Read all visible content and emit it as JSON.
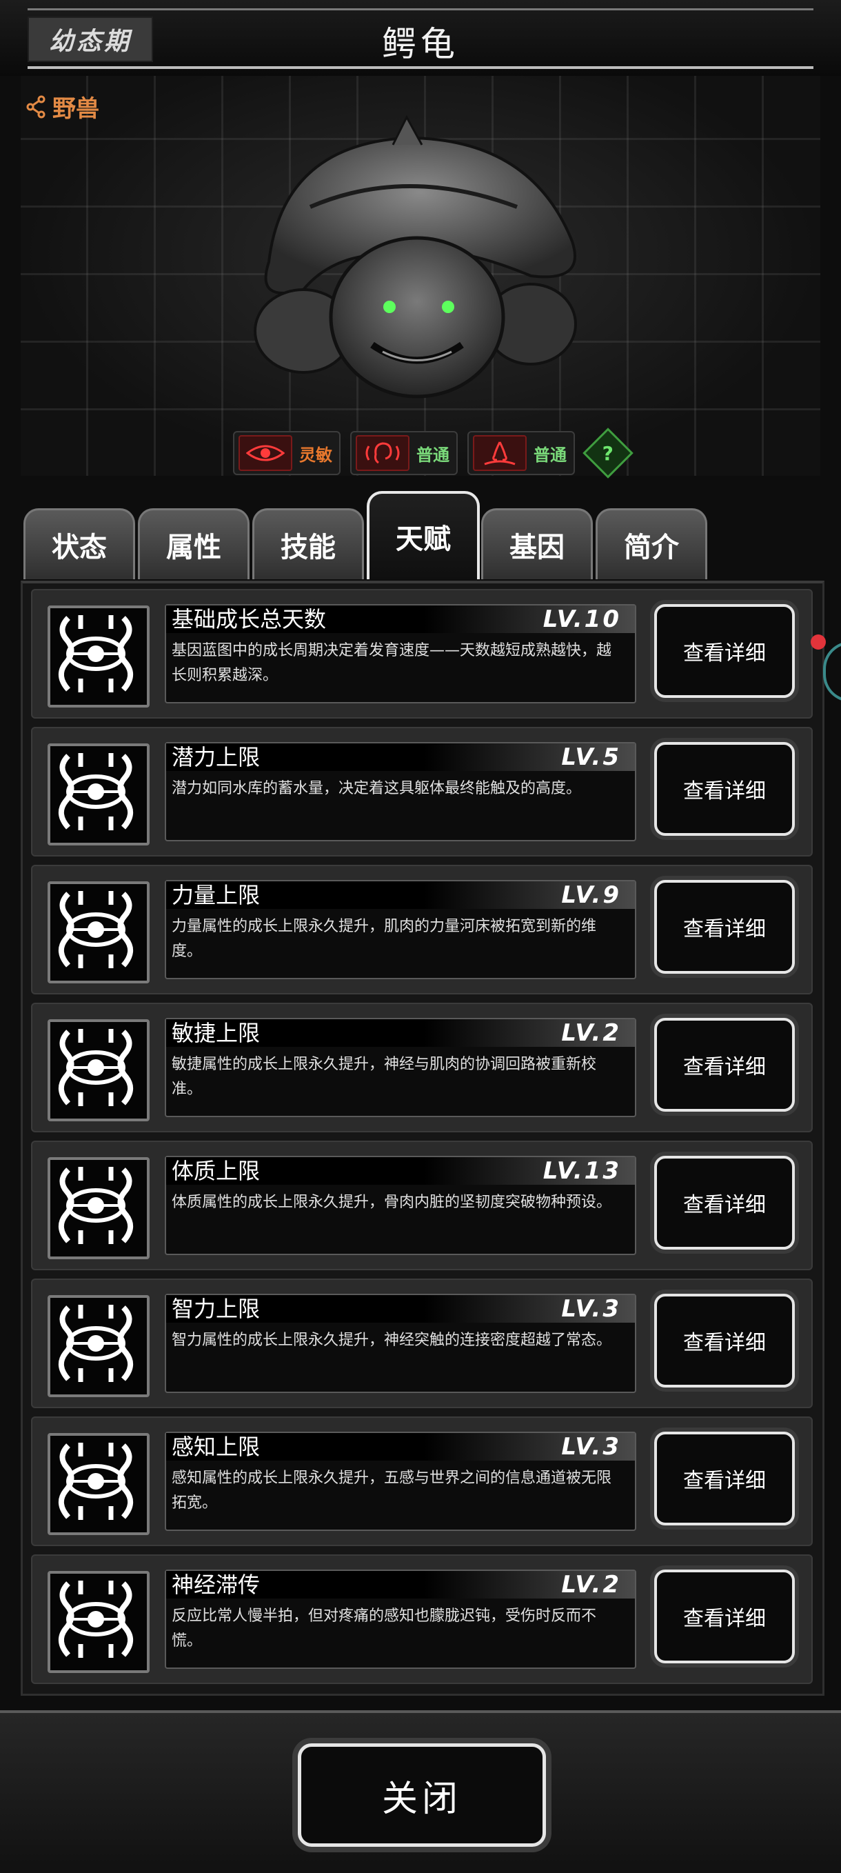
{
  "header": {
    "stage": "幼态期",
    "title": "鳄龟"
  },
  "hero": {
    "category": "野兽",
    "traits": [
      {
        "label": "灵敏",
        "color": "#e8782d",
        "icon": "eye-icon"
      },
      {
        "label": "普通",
        "color": "#7ad97a",
        "icon": "ear-icon"
      },
      {
        "label": "普通",
        "color": "#7ad97a",
        "icon": "nose-icon"
      }
    ],
    "help": "?"
  },
  "tabs": [
    {
      "label": "状态",
      "active": false
    },
    {
      "label": "属性",
      "active": false
    },
    {
      "label": "技能",
      "active": false
    },
    {
      "label": "天赋",
      "active": true
    },
    {
      "label": "基因",
      "active": false
    },
    {
      "label": "简介",
      "active": false
    }
  ],
  "talents": [
    {
      "name": "基础成长总天数",
      "level": "LV.10",
      "desc": "基因蓝图中的成长周期决定着发育速度——天数越短成熟越快，越长则积累越深。",
      "button": "查看详细"
    },
    {
      "name": "潜力上限",
      "level": "LV.5",
      "desc": "潜力如同水库的蓄水量，决定着这具躯体最终能触及的高度。",
      "button": "查看详细"
    },
    {
      "name": "力量上限",
      "level": "LV.9",
      "desc": "力量属性的成长上限永久提升，肌肉的力量河床被拓宽到新的维度。",
      "button": "查看详细"
    },
    {
      "name": "敏捷上限",
      "level": "LV.2",
      "desc": "敏捷属性的成长上限永久提升，神经与肌肉的协调回路被重新校准。",
      "button": "查看详细"
    },
    {
      "name": "体质上限",
      "level": "LV.13",
      "desc": "体质属性的成长上限永久提升，骨肉内脏的坚韧度突破物种预设。",
      "button": "查看详细"
    },
    {
      "name": "智力上限",
      "level": "LV.3",
      "desc": "智力属性的成长上限永久提升，神经突触的连接密度超越了常态。",
      "button": "查看详细"
    },
    {
      "name": "感知上限",
      "level": "LV.3",
      "desc": "感知属性的成长上限永久提升，五感与世界之间的信息通道被无限拓宽。",
      "button": "查看详细"
    },
    {
      "name": "神经滞传",
      "level": "LV.2",
      "desc": "反应比常人慢半拍，但对疼痛的感知也朦胧迟钝，受伤时反而不慌。",
      "button": "查看详细"
    }
  ],
  "footer": {
    "close": "关闭"
  }
}
